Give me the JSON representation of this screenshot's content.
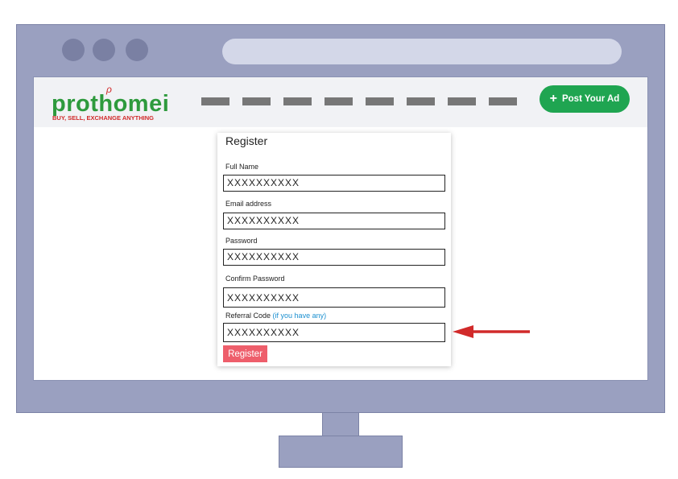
{
  "browser": {
    "window_dots": [
      "window-dot",
      "window-dot",
      "window-dot"
    ]
  },
  "navbar": {
    "logo": {
      "name": "prothomei",
      "tagline": "BUY, SELL, EXCHANGE ANYTHING",
      "mark": "ρ"
    },
    "nav_link_count": 8,
    "post_ad_label": "Post Your Ad",
    "post_ad_icon": "plus-icon"
  },
  "register_form": {
    "title": "Register",
    "fields": [
      {
        "label": "Full Name",
        "value": "XXXXXXXXXX"
      },
      {
        "label": "Email address",
        "value": "XXXXXXXXXX"
      },
      {
        "label": "Password",
        "value": "XXXXXXXXXX"
      },
      {
        "label": "Confirm Password",
        "value": "XXXXXXXXXX"
      },
      {
        "label": "Referral Code",
        "hint": "(if you have any)",
        "value": "XXXXXXXXXX"
      }
    ],
    "submit_label": "Register"
  },
  "colors": {
    "brand_green": "#2e9a3d",
    "button_green": "#1fa551",
    "register_red": "#ee5e6b",
    "arrow_red": "#d12a2a",
    "hint_blue": "#1a8fd0"
  },
  "annotation": {
    "icon": "arrow-left-icon"
  }
}
